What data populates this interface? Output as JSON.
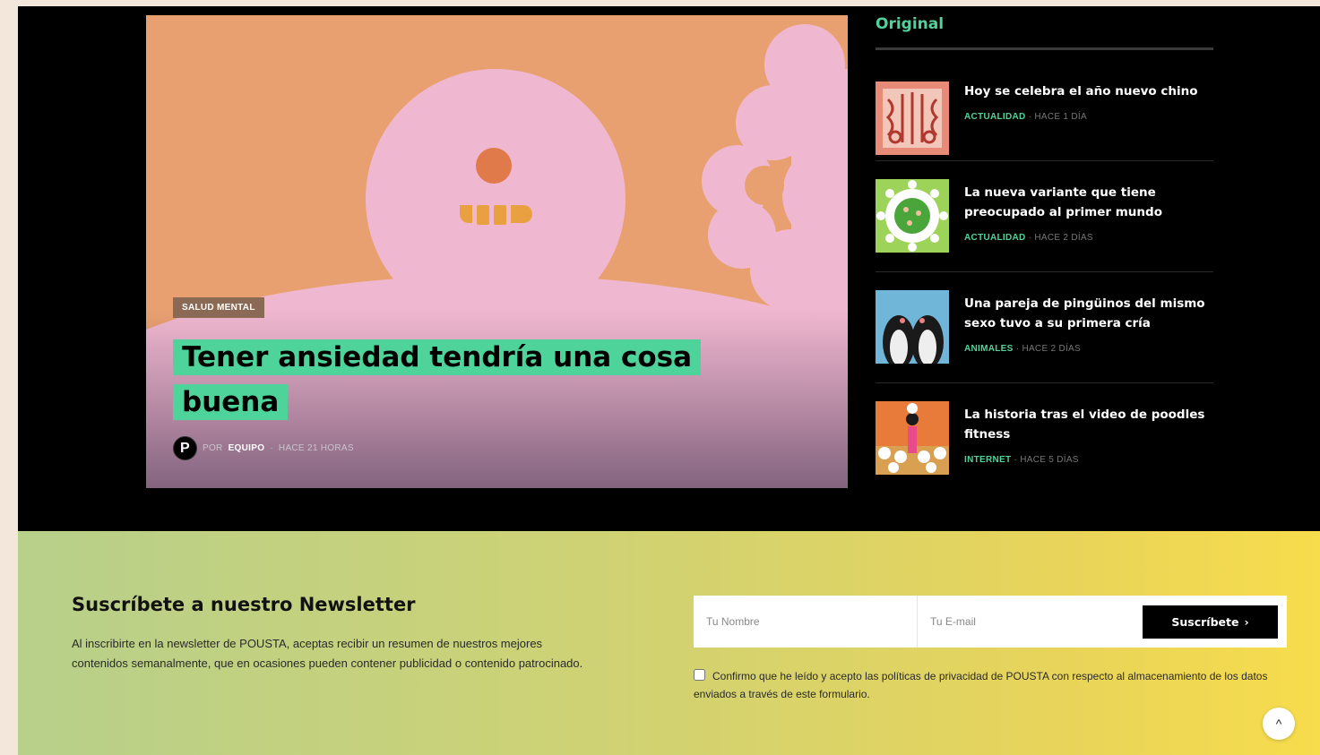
{
  "hero": {
    "tag": "SALUD MENTAL",
    "title": "Tener ansiedad tendría una cosa buena",
    "avatar_letter": "P",
    "by_prefix": "POR",
    "author": "EQUIPO",
    "separator": "·",
    "time": "HACE 21 HORAS"
  },
  "sidebar": {
    "title": "Original",
    "items": [
      {
        "title": "Hoy se celebra el año nuevo chino",
        "category": "ACTUALIDAD",
        "time": "HACE 1 DÍA",
        "thumb_icon": "tiger-illustration-icon"
      },
      {
        "title": "La nueva variante que tiene preocupado al primer mundo",
        "category": "ACTUALIDAD",
        "time": "HACE 2 DÍAS",
        "thumb_icon": "virus-illustration-icon"
      },
      {
        "title": "Una pareja de pingüinos del mismo sexo tuvo a su primera cría",
        "category": "ANIMALES",
        "time": "HACE 2 DÍAS",
        "thumb_icon": "penguins-photo-icon"
      },
      {
        "title": "La historia tras el video de poodles fitness",
        "category": "INTERNET",
        "time": "HACE 5 DÍAS",
        "thumb_icon": "poodles-illustration-icon"
      }
    ]
  },
  "newsletter": {
    "title": "Suscríbete a nuestro Newsletter",
    "description": "Al inscribirte en la newsletter de POUSTA, aceptas recibir un resumen de nuestros mejores contenidos semanalmente, que en ocasiones pueden contener publicidad o contenido patrocinado.",
    "name_placeholder": "Tu Nombre",
    "email_placeholder": "Tu E-mail",
    "submit_label": "Suscríbete",
    "submit_arrow": "›",
    "consent_text": "Confirmo que he leído y acepto las políticas de privacidad de POUSTA con respecto al almacenamiento de los datos enviados a través de este formulario."
  },
  "scroll_top_icon": "^",
  "colors": {
    "accent": "#4ed49a",
    "background": "#000000",
    "hero_bg": "#e8a070"
  }
}
